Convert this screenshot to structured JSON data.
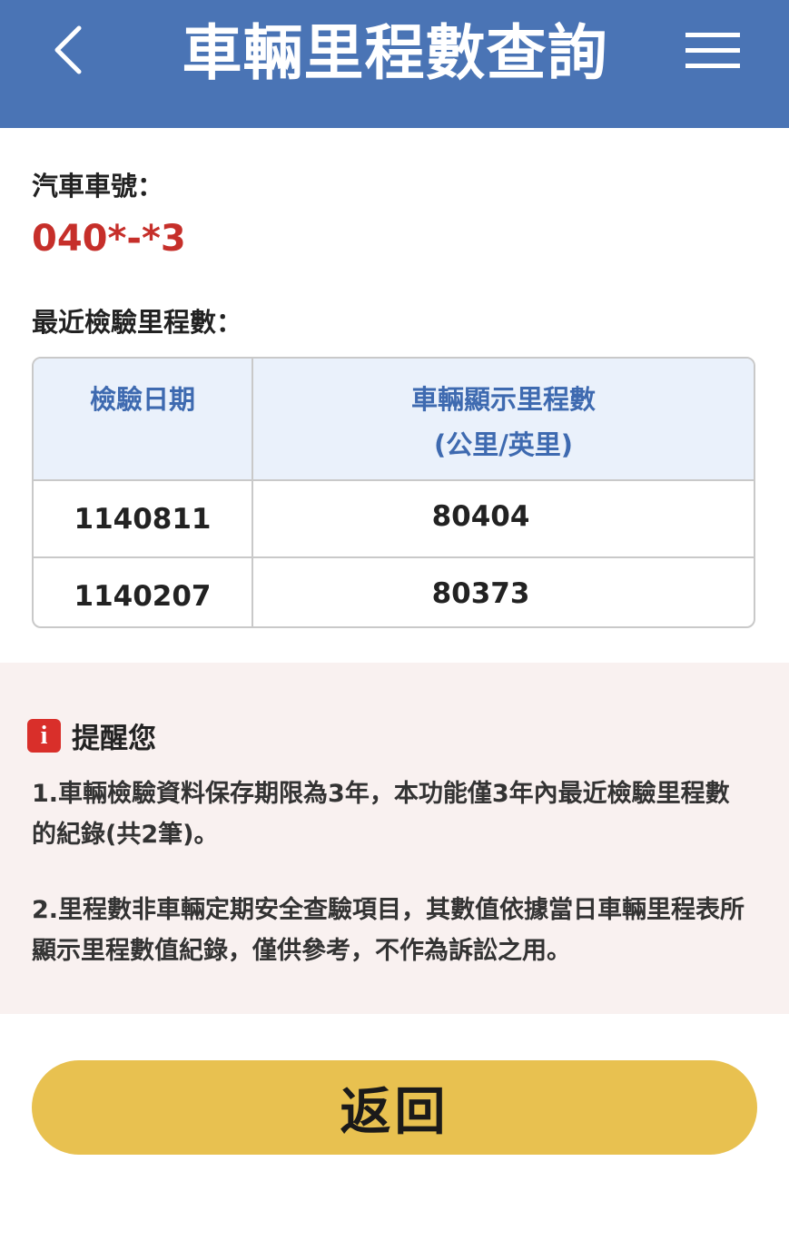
{
  "header": {
    "title": "車輛里程數查詢",
    "back_icon": "chevron-left-icon",
    "menu_icon": "hamburger-menu-icon"
  },
  "vehicle": {
    "plate_label": "汽車車號：",
    "plate_value": "040*-*3"
  },
  "mileage": {
    "section_label": "最近檢驗里程數：",
    "columns": [
      "檢驗日期",
      "車輛顯示里程數",
      "(公里/英里)"
    ],
    "rows": [
      {
        "date": "1140811",
        "mileage": "80404"
      },
      {
        "date": "1140207",
        "mileage": "80373"
      }
    ]
  },
  "notice": {
    "icon": "info-icon",
    "title": "提醒您",
    "items": [
      "1.車輛檢驗資料保存期限為3年，本功能僅3年內最近檢驗里程數的紀錄(共2筆)。",
      "2.里程數非車輛定期安全查驗項目，其數值依據當日車輛里程表所顯示里程數值紀錄，僅供參考，不作為訴訟之用。"
    ]
  },
  "actions": {
    "return_label": "返回"
  },
  "colors": {
    "header_bg": "#4a74b5",
    "plate_red": "#c62f2a",
    "table_header_bg": "#eaf1fb",
    "table_header_text": "#3e6ab0",
    "notice_bg": "#f9f1f0",
    "info_red": "#d92f2a",
    "button_yellow": "#e8c150"
  }
}
